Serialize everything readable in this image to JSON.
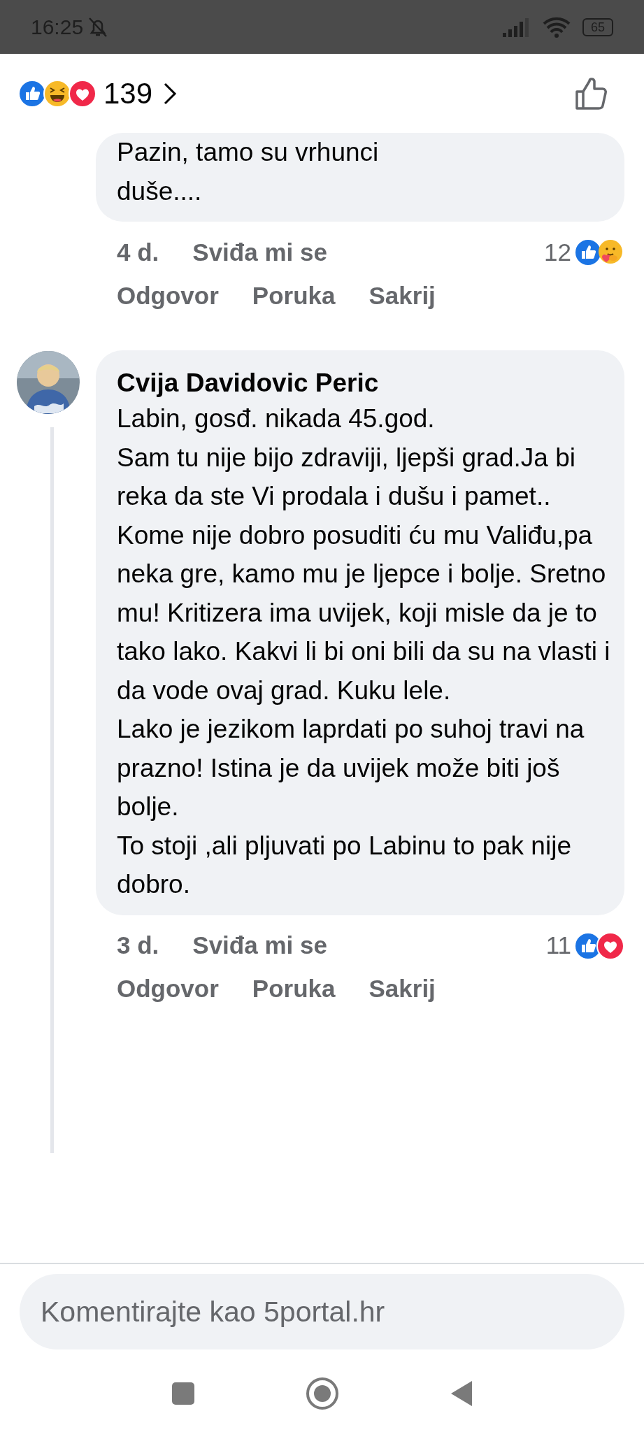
{
  "status_bar": {
    "time": "16:25",
    "battery": "65"
  },
  "reactions_summary": {
    "count": "139",
    "reactions": [
      {
        "kind": "like"
      },
      {
        "kind": "haha"
      },
      {
        "kind": "love"
      }
    ]
  },
  "comments": [
    {
      "text": "Pazin, tamo su vrhunci\nduše....",
      "time": "4 d.",
      "like_label": "Sviđa mi se",
      "reaction_count": "12",
      "reactions": [
        {
          "kind": "like"
        },
        {
          "kind": "care"
        }
      ],
      "actions": [
        "Odgovor",
        "Poruka",
        "Sakrij"
      ]
    },
    {
      "author": "Cvija Davidovic Peric",
      "has_avatar": true,
      "text": "Labin, gosđ. nikada 45.god.\nSam tu nije bijo zdraviji, ljepši grad.Ja bi reka da ste Vi prodala i dušu i pamet..\nKome nije dobro posuditi ću mu Valiđu,pa neka gre, kamo mu je ljepce i bolje. Sretno mu! Kritizera ima uvijek, koji misle da je to tako lako. Kakvi li bi oni bili da su na vlasti i da vode ovaj grad. Kuku lele.\nLako je jezikom laprdati  po suhoj travi na prazno! Istina je da uvijek može biti još bolje.\nTo stoji ,ali pljuvati po Labinu to pak nije dobro.",
      "time": "3 d.",
      "like_label": "Sviđa mi se",
      "reaction_count": "11",
      "reactions": [
        {
          "kind": "like"
        },
        {
          "kind": "love"
        }
      ],
      "actions": [
        "Odgovor",
        "Poruka",
        "Sakrij"
      ]
    }
  ],
  "comment_box": {
    "placeholder": "Komentirajte kao 5portal.hr"
  }
}
